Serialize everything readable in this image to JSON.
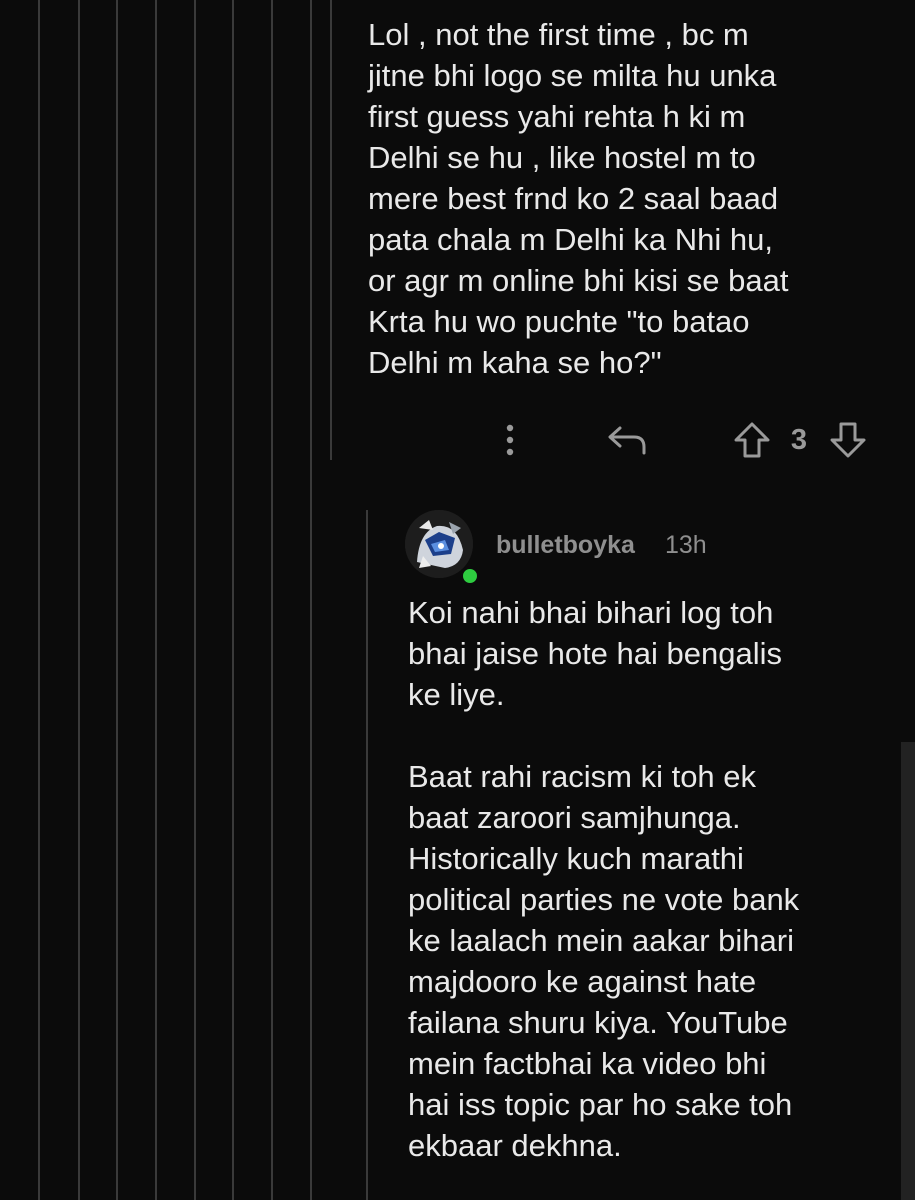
{
  "parent_comment": {
    "body": "Lol , not the first time , bc m\njitne bhi logo se milta hu unka\nfirst guess yahi rehta h ki m\nDelhi se hu , like hostel m to\nmere best frnd ko 2 saal baad\npata chala m Delhi ka Nhi hu,\nor agr m online bhi kisi se baat\nKrta hu wo puchte \"to batao\nDelhi m kaha se ho?\"",
    "score": "3",
    "icons": {
      "more": "vertical-ellipsis-icon",
      "reply": "reply-arrow-icon",
      "upvote": "upvote-arrow-icon",
      "downvote": "downvote-arrow-icon"
    }
  },
  "reply": {
    "username": "bulletboyka",
    "timestamp": "13h",
    "online": true,
    "paragraphs": [
      "Koi nahi bhai bihari log toh\nbhai jaise hote hai bengalis\nke liye.",
      "Baat rahi racism ki toh ek\nbaat zaroori samjhunga.\nHistorically kuch marathi\npolitical parties ne vote bank\nke laalach mein aakar bihari\nmajdooro ke against hate\nfailana shuru kiya. YouTube\nmein factbhai ka video bhi\nhai iss topic par ho sake toh\nekbaar dekhna."
    ]
  },
  "colors": {
    "background": "#0b0b0b",
    "text": "#e9e9e9",
    "muted": "#8f8f8f",
    "thread_line": "#3a3a3a",
    "online": "#2ecc40"
  }
}
